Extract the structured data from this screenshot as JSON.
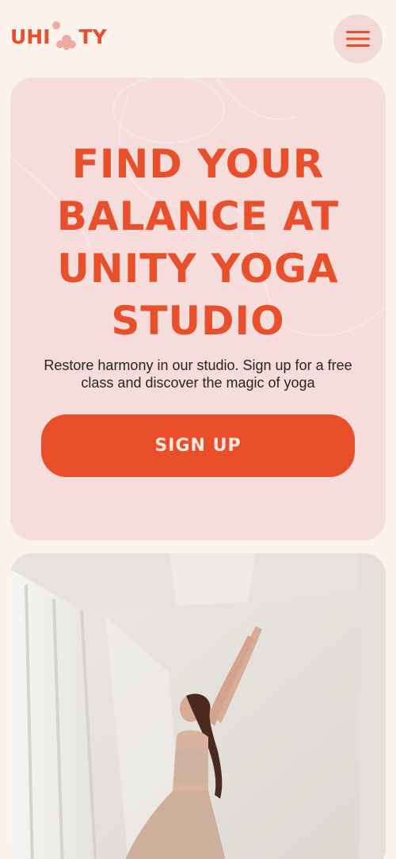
{
  "header": {
    "logo_left": "UHI",
    "logo_right": "TY",
    "logo_icon": "flower-icon",
    "menu_icon": "hamburger-menu-icon"
  },
  "hero": {
    "title": "FIND YOUR BALANCE AT UNITY YOGA STUDIO",
    "subtitle": "Restore harmony in our studio. Sign up for a free class and discover the magic of yoga",
    "cta_label": "SIGN UP"
  },
  "photo": {
    "icon": "yoga-woman-photo"
  },
  "colors": {
    "background": "#fbf3ec",
    "accent": "#e8502b",
    "hero_bg": "#f6dcdb",
    "menu_bg": "#f3d9d6",
    "text": "#2a2320"
  }
}
